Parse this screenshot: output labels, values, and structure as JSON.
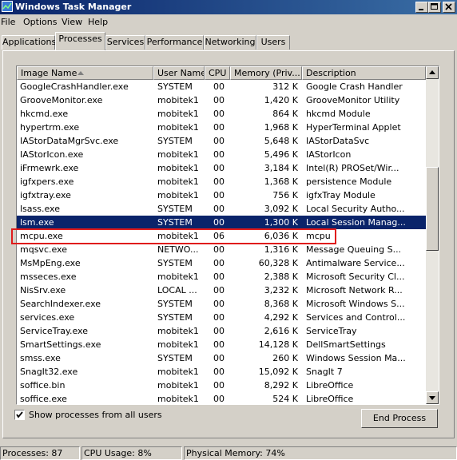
{
  "window": {
    "title": "Windows Task Manager"
  },
  "menu": [
    "File",
    "Options",
    "View",
    "Help"
  ],
  "tabs": [
    "Applications",
    "Processes",
    "Services",
    "Performance",
    "Networking",
    "Users"
  ],
  "active_tab": "Processes",
  "columns": {
    "name": "Image Name",
    "user": "User Name",
    "cpu": "CPU",
    "memory": "Memory (Priv...",
    "description": "Description"
  },
  "processes": [
    {
      "name": "GoogleCrashHandler.exe",
      "user": "SYSTEM",
      "cpu": "00",
      "memory": "312 K",
      "description": "Google Crash Handler"
    },
    {
      "name": "GrooveMonitor.exe",
      "user": "mobitek1",
      "cpu": "00",
      "memory": "1,420 K",
      "description": "GrooveMonitor Utility"
    },
    {
      "name": "hkcmd.exe",
      "user": "mobitek1",
      "cpu": "00",
      "memory": "864 K",
      "description": "hkcmd Module"
    },
    {
      "name": "hypertrm.exe",
      "user": "mobitek1",
      "cpu": "00",
      "memory": "1,968 K",
      "description": "HyperTerminal Applet"
    },
    {
      "name": "IAStorDataMgrSvc.exe",
      "user": "SYSTEM",
      "cpu": "00",
      "memory": "5,648 K",
      "description": "IAStorDataSvc"
    },
    {
      "name": "IAStorIcon.exe",
      "user": "mobitek1",
      "cpu": "00",
      "memory": "5,496 K",
      "description": "IAStorIcon"
    },
    {
      "name": "iFrmewrk.exe",
      "user": "mobitek1",
      "cpu": "00",
      "memory": "3,184 K",
      "description": "Intel(R) PROSet/Wir..."
    },
    {
      "name": "igfxpers.exe",
      "user": "mobitek1",
      "cpu": "00",
      "memory": "1,368 K",
      "description": "persistence Module"
    },
    {
      "name": "igfxtray.exe",
      "user": "mobitek1",
      "cpu": "00",
      "memory": "756 K",
      "description": "igfxTray Module"
    },
    {
      "name": "lsass.exe",
      "user": "SYSTEM",
      "cpu": "00",
      "memory": "3,092 K",
      "description": "Local Security Autho..."
    },
    {
      "name": "lsm.exe",
      "user": "SYSTEM",
      "cpu": "00",
      "memory": "1,300 K",
      "description": "Local Session Manag..."
    },
    {
      "name": "mcpu.exe",
      "user": "mobitek1",
      "cpu": "06",
      "memory": "6,036 K",
      "description": "mcpu"
    },
    {
      "name": "mqsvc.exe",
      "user": "NETWO...",
      "cpu": "00",
      "memory": "1,316 K",
      "description": "Message Queuing S..."
    },
    {
      "name": "MsMpEng.exe",
      "user": "SYSTEM",
      "cpu": "00",
      "memory": "60,328 K",
      "description": "Antimalware Service..."
    },
    {
      "name": "msseces.exe",
      "user": "mobitek1",
      "cpu": "00",
      "memory": "2,388 K",
      "description": "Microsoft Security Cl..."
    },
    {
      "name": "NisSrv.exe",
      "user": "LOCAL ...",
      "cpu": "00",
      "memory": "3,232 K",
      "description": "Microsoft Network R..."
    },
    {
      "name": "SearchIndexer.exe",
      "user": "SYSTEM",
      "cpu": "00",
      "memory": "8,368 K",
      "description": "Microsoft Windows S..."
    },
    {
      "name": "services.exe",
      "user": "SYSTEM",
      "cpu": "00",
      "memory": "4,292 K",
      "description": "Services and Control..."
    },
    {
      "name": "ServiceTray.exe",
      "user": "mobitek1",
      "cpu": "00",
      "memory": "2,616 K",
      "description": "ServiceTray"
    },
    {
      "name": "SmartSettings.exe",
      "user": "mobitek1",
      "cpu": "00",
      "memory": "14,128 K",
      "description": "DellSmartSettings"
    },
    {
      "name": "smss.exe",
      "user": "SYSTEM",
      "cpu": "00",
      "memory": "260 K",
      "description": "Windows Session Ma..."
    },
    {
      "name": "SnagIt32.exe",
      "user": "mobitek1",
      "cpu": "00",
      "memory": "15,092 K",
      "description": "SnagIt 7"
    },
    {
      "name": "soffice.bin",
      "user": "mobitek1",
      "cpu": "00",
      "memory": "8,292 K",
      "description": "LibreOffice"
    },
    {
      "name": "soffice.exe",
      "user": "mobitek1",
      "cpu": "00",
      "memory": "524 K",
      "description": "LibreOffice"
    }
  ],
  "selected_process": "lsm.exe",
  "highlighted_process": "mcpu.exe",
  "show_all": {
    "label": "Show processes from all users",
    "checked": true
  },
  "end_process_label": "End Process",
  "status": {
    "processes": "Processes: 87",
    "cpu": "CPU Usage: 8%",
    "memory": "Physical Memory: 74%"
  },
  "colors": {
    "selection": "#0a246a",
    "highlight_box": "#e01b1b",
    "titlebar": "#0a246a"
  },
  "icons": [
    "task-manager-icon",
    "minimize-icon",
    "maximize-icon",
    "close-icon",
    "sort-arrow-icon",
    "scroll-up-icon",
    "scroll-down-icon",
    "checkmark-icon"
  ]
}
